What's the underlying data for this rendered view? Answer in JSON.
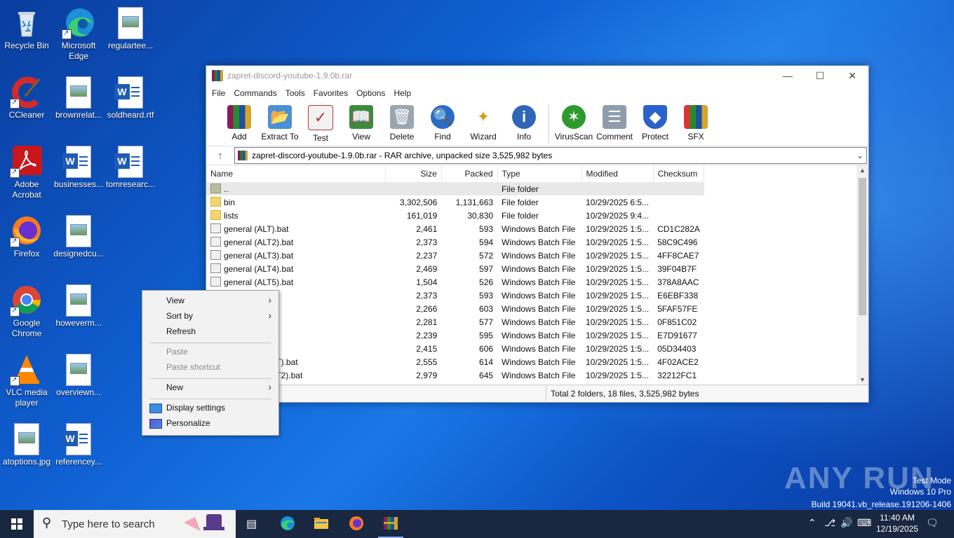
{
  "desktop": {
    "icons": [
      {
        "label": "Recycle Bin"
      },
      {
        "label": "Microsoft Edge"
      },
      {
        "label": "regulartee..."
      },
      {
        "label": "CCleaner"
      },
      {
        "label": "brownrelat..."
      },
      {
        "label": "soldheard.rtf"
      },
      {
        "label": "Adobe Acrobat"
      },
      {
        "label": "businesses..."
      },
      {
        "label": "tomresearc..."
      },
      {
        "label": "Firefox"
      },
      {
        "label": "designedcu..."
      },
      {
        "label": "Google Chrome"
      },
      {
        "label": "howeverm..."
      },
      {
        "label": "VLC media player"
      },
      {
        "label": "overviewn..."
      },
      {
        "label": "atoptions.jpg"
      },
      {
        "label": "referencey..."
      }
    ]
  },
  "winrar": {
    "title": "zapret-discord-youtube-1.9.0b.rar",
    "menu": [
      "File",
      "Commands",
      "Tools",
      "Favorites",
      "Options",
      "Help"
    ],
    "toolbar": [
      {
        "label": "Add",
        "icon": "add-icon"
      },
      {
        "label": "Extract To",
        "icon": "extract-icon"
      },
      {
        "label": "Test",
        "icon": "test-icon"
      },
      {
        "label": "View",
        "icon": "view-icon"
      },
      {
        "label": "Delete",
        "icon": "delete-icon"
      },
      {
        "label": "Find",
        "icon": "find-icon"
      },
      {
        "label": "Wizard",
        "icon": "wizard-icon"
      },
      {
        "label": "Info",
        "icon": "info-icon"
      },
      {
        "label": "VirusScan",
        "icon": "virusscan-icon"
      },
      {
        "label": "Comment",
        "icon": "comment-icon"
      },
      {
        "label": "Protect",
        "icon": "protect-icon"
      },
      {
        "label": "SFX",
        "icon": "sfx-icon"
      }
    ],
    "address": "zapret-discord-youtube-1.9.0b.rar - RAR archive, unpacked size 3,525,982 bytes",
    "columns": {
      "name": "Name",
      "size": "Size",
      "packed": "Packed",
      "type": "Type",
      "modified": "Modified",
      "checksum": "Checksum"
    },
    "rows": [
      {
        "name": "..",
        "size": "",
        "packed": "",
        "type": "File folder",
        "modified": "",
        "checksum": "",
        "kind": "up"
      },
      {
        "name": "bin",
        "size": "3,302,506",
        "packed": "1,131,663",
        "type": "File folder",
        "modified": "10/29/2025 6:5...",
        "checksum": "",
        "kind": "folder"
      },
      {
        "name": "lists",
        "size": "161,019",
        "packed": "30,830",
        "type": "File folder",
        "modified": "10/29/2025 9:4...",
        "checksum": "",
        "kind": "folder"
      },
      {
        "name": "general (ALT).bat",
        "size": "2,461",
        "packed": "593",
        "type": "Windows Batch File",
        "modified": "10/29/2025 1:5...",
        "checksum": "CD1C282A",
        "kind": "bat"
      },
      {
        "name": "general (ALT2).bat",
        "size": "2,373",
        "packed": "594",
        "type": "Windows Batch File",
        "modified": "10/29/2025 1:5...",
        "checksum": "58C9C496",
        "kind": "bat"
      },
      {
        "name": "general (ALT3).bat",
        "size": "2,237",
        "packed": "572",
        "type": "Windows Batch File",
        "modified": "10/29/2025 1:5...",
        "checksum": "4FF8CAE7",
        "kind": "bat"
      },
      {
        "name": "general (ALT4).bat",
        "size": "2,469",
        "packed": "597",
        "type": "Windows Batch File",
        "modified": "10/29/2025 1:5...",
        "checksum": "39F04B7F",
        "kind": "bat"
      },
      {
        "name": "general (ALT5).bat",
        "size": "1,504",
        "packed": "526",
        "type": "Windows Batch File",
        "modified": "10/29/2025 1:5...",
        "checksum": "378A8AAC",
        "kind": "bat"
      },
      {
        "name": "bat",
        "size": "2,373",
        "packed": "593",
        "type": "Windows Batch File",
        "modified": "10/29/2025 1:5...",
        "checksum": "E6EBF338",
        "kind": "bat"
      },
      {
        "name": "bat",
        "size": "2,266",
        "packed": "603",
        "type": "Windows Batch File",
        "modified": "10/29/2025 1:5...",
        "checksum": "5FAF57FE",
        "kind": "bat"
      },
      {
        "name": "bat",
        "size": "2,281",
        "packed": "577",
        "type": "Windows Batch File",
        "modified": "10/29/2025 1:5...",
        "checksum": "0F851C02",
        "kind": "bat"
      },
      {
        "name": "bat",
        "size": "2,239",
        "packed": "595",
        "type": "Windows Batch File",
        "modified": "10/29/2025 1:5...",
        "checksum": "E7D91677",
        "kind": "bat"
      },
      {
        "name": ".bat",
        "size": "2,415",
        "packed": "606",
        "type": "Windows Batch File",
        "modified": "10/29/2025 1:5...",
        "checksum": "05D34403",
        "kind": "bat"
      },
      {
        "name": "TLS AUTO ALT).bat",
        "size": "2,555",
        "packed": "614",
        "type": "Windows Batch File",
        "modified": "10/29/2025 1:5...",
        "checksum": "4F02ACE2",
        "kind": "bat"
      },
      {
        "name": "TLS AUTO ALT2).bat",
        "size": "2,979",
        "packed": "645",
        "type": "Windows Batch File",
        "modified": "10/29/2025 1:5...",
        "checksum": "32212FC1",
        "kind": "bat"
      }
    ],
    "status": "Total 2 folders, 18 files, 3,525,982 bytes"
  },
  "context_menu": {
    "view": "View",
    "sort_by": "Sort by",
    "refresh": "Refresh",
    "paste": "Paste",
    "paste_shortcut": "Paste shortcut",
    "new": "New",
    "display_settings": "Display settings",
    "personalize": "Personalize"
  },
  "taskbar": {
    "search_placeholder": "Type here to search",
    "time": "11:40 AM",
    "date": "12/19/2025"
  },
  "watermark": {
    "brand": "ANY RUN",
    "test_mode": "Test Mode",
    "edition": "Windows 10 Pro",
    "build": "Build 19041.vb_release.191206-1406"
  }
}
